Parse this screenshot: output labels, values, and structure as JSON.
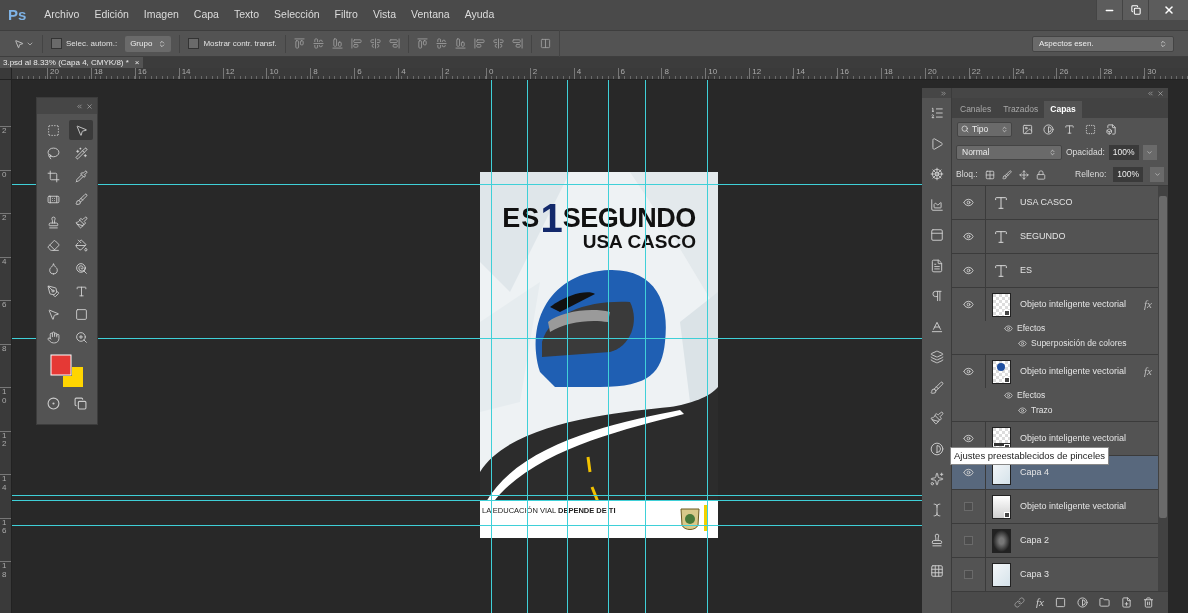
{
  "app": {
    "logo": "Ps",
    "menu": [
      "Archivo",
      "Edición",
      "Imagen",
      "Capa",
      "Texto",
      "Selección",
      "Filtro",
      "Vista",
      "Ventana",
      "Ayuda"
    ]
  },
  "options_bar": {
    "auto_select": {
      "label": "Selec. autom.:",
      "checked": false
    },
    "auto_select_mode": "Grupo",
    "show_transform": {
      "label": "Mostrar contr. transf.",
      "checked": false
    },
    "workspace": "Aspectos esen."
  },
  "document_tab": {
    "title": "3.psd al 8.33% (Capa 4, CMYK/8) *",
    "close": "×"
  },
  "rulers": {
    "horizontal": [
      "20",
      "18",
      "16",
      "14",
      "12",
      "10",
      "8",
      "6",
      "4",
      "2",
      "0",
      "2",
      "4",
      "6",
      "8",
      "10",
      "12",
      "14",
      "16",
      "18",
      "20",
      "22",
      "24",
      "26",
      "28",
      "30"
    ],
    "vertical": [
      "2",
      "0",
      "2",
      "4",
      "6",
      "8",
      "10",
      "12",
      "14",
      "16",
      "18"
    ]
  },
  "tools": [
    {
      "selected": false
    },
    {
      "selected": true
    },
    {
      "selected": false
    },
    {
      "selected": false
    },
    {
      "selected": false
    },
    {
      "selected": false
    },
    {
      "selected": false
    },
    {
      "selected": false
    },
    {
      "selected": false
    },
    {
      "selected": false
    },
    {
      "selected": false
    },
    {
      "selected": false
    },
    {
      "selected": false
    },
    {
      "selected": false
    },
    {
      "selected": false
    },
    {
      "selected": false
    },
    {
      "selected": false
    },
    {
      "selected": false
    },
    {
      "selected": false
    },
    {
      "selected": false
    }
  ],
  "swatches": [
    {
      "kind": "foreground",
      "color": "#e53935"
    },
    {
      "kind": "background",
      "color": "#ffd500"
    }
  ],
  "poster": {
    "headline_left": "ES",
    "number": "1",
    "headline_right": "SEGUNDO",
    "subline": "USA CASCO",
    "footer": "LA EDUCACIÓN VIAL **DEPENDE DE TI**"
  },
  "layers_panel": {
    "tabs": [
      {
        "label": "Canales",
        "selected": false
      },
      {
        "label": "Trazados",
        "selected": false
      },
      {
        "label": "Capas",
        "selected": true
      }
    ],
    "filter": "Tipo",
    "blend_mode": "Normal",
    "opacity_label": "Opacidad:",
    "opacity": "100%",
    "lock_label": "Bloq.:",
    "fill_label": "Relleno:",
    "fill": "100%",
    "footer_fx": "fx",
    "layers": [
      {
        "kind": "text",
        "name": "USA CASCO",
        "visible": true,
        "selected": false
      },
      {
        "kind": "text",
        "name": "SEGUNDO",
        "visible": true,
        "selected": false
      },
      {
        "kind": "text",
        "name": "ES",
        "visible": true,
        "selected": false
      },
      {
        "kind": "smart",
        "thumbnail": {
          "kind": "checker"
        },
        "name": "Objeto inteligente vectorial",
        "badge": "fx",
        "visible": true,
        "selected": false,
        "effects": {
          "label": "Efectos",
          "items": [
            "Superposición de colores"
          ]
        }
      },
      {
        "kind": "smart",
        "thumbnail": {
          "kind": "helmet"
        },
        "name": "Objeto inteligente vectorial",
        "badge": "fx",
        "visible": true,
        "selected": false,
        "effects": {
          "label": "Efectos",
          "items": [
            "Trazo"
          ]
        }
      },
      {
        "kind": "smart",
        "thumbnail": {
          "kind": "road"
        },
        "name": "Objeto inteligente vectorial",
        "visible": true,
        "selected": false
      },
      {
        "kind": "pixel",
        "thumbnail": {
          "kind": "light"
        },
        "name": "Capa 4",
        "visible": true,
        "selected": true
      },
      {
        "kind": "smart",
        "thumbnail": {
          "kind": "gradient"
        },
        "name": "Objeto inteligente vectorial",
        "visible": false,
        "selected": false
      },
      {
        "kind": "pixel",
        "thumbnail": {
          "kind": "texture"
        },
        "name": "Capa 2",
        "visible": false,
        "selected": false
      },
      {
        "kind": "pixel",
        "thumbnail": {
          "kind": "light"
        },
        "name": "Capa 3",
        "visible": false,
        "selected": false
      }
    ]
  },
  "tooltip": "Ajustes preestablecidos de pinceles"
}
